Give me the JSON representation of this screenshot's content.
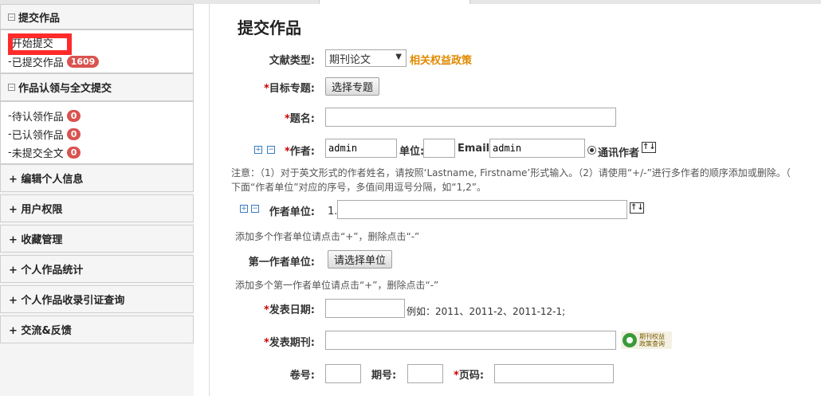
{
  "sidebar": {
    "section1": {
      "title": "提交作品",
      "items": [
        {
          "label": "开始提交",
          "prefix": "- "
        },
        {
          "label": "已提交作品",
          "prefix": "- ",
          "badge": "1609"
        }
      ]
    },
    "section2": {
      "title": "作品认领与全文提交",
      "items": [
        {
          "label": "待认领作品",
          "prefix": "- ",
          "badge": "0"
        },
        {
          "label": "已认领作品",
          "prefix": "- ",
          "badge": "0"
        },
        {
          "label": "未提交全文",
          "prefix": "- ",
          "badge": "0"
        }
      ]
    },
    "collapsed": [
      {
        "label": "+ 编辑个人信息"
      },
      {
        "label": "+ 用户权限"
      },
      {
        "label": "+ 收藏管理"
      },
      {
        "label": "+ 个人作品统计"
      },
      {
        "label": "+ 个人作品收录引证查询"
      },
      {
        "label": "+ 交流&反馈"
      }
    ]
  },
  "main": {
    "title": "提交作品",
    "doc_type": {
      "label": "文献类型:",
      "value": "期刊论文",
      "policy_link": "相关权益政策"
    },
    "topic": {
      "label": "目标专题:",
      "button": "选择专题"
    },
    "name": {
      "label": "题名:"
    },
    "author": {
      "label": "作者:",
      "value": "admin",
      "unit_label": "单位:",
      "email_label": "Email:",
      "email_value": "admin",
      "corr_label": "通讯作者"
    },
    "note1": "注意：（1）对于英文形式的作者姓名，请按照‘Lastname, Firstname’形式输入。（2）请使用“+/-”进行多作者的顺序添加或删除。（",
    "note2": "下面“作者单位”对应的序号，多值间用逗号分隔，如“1,2”。",
    "affil": {
      "label": "作者单位:",
      "index": "1."
    },
    "affil_hint": "添加多个作者单位请点击“+”，删除点击“-”",
    "first_affil": {
      "label": "第一作者单位:",
      "button": "请选择单位"
    },
    "first_hint": "添加多个第一作者单位请点击“+”，删除点击“-”",
    "pub_date": {
      "label": "发表日期:",
      "example": "例如：2011、2011-2、2011-12-1;"
    },
    "journal": {
      "label": "发表期刊:",
      "logo_line1": "期刊权益",
      "logo_line2": "政策查询"
    },
    "volume": {
      "label": "卷号:"
    },
    "issue": {
      "label": "期号:"
    },
    "pages": {
      "label": "页码:"
    },
    "req_mark": "*"
  }
}
